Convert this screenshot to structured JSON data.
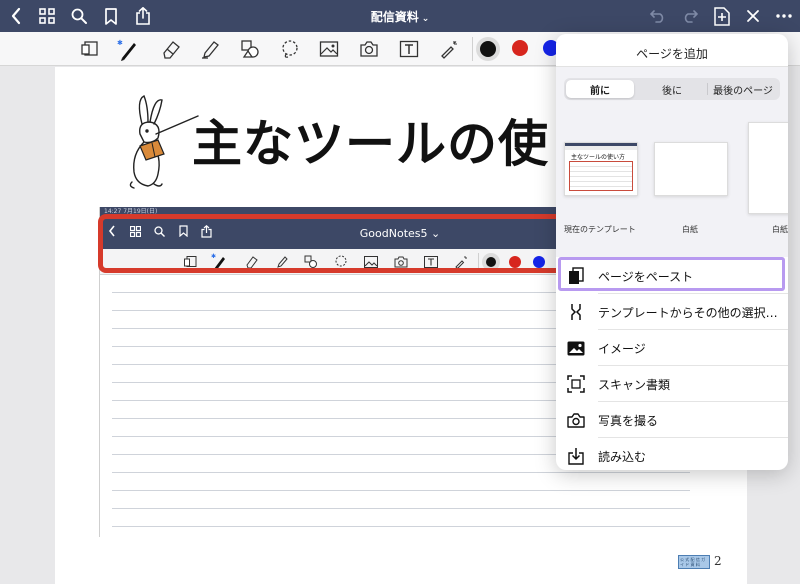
{
  "nav": {
    "title": "配信資料",
    "chevron": "⌄"
  },
  "colors": {
    "navbar": "#3d4866",
    "black_pen": "#111111",
    "red_pen": "#d7261e",
    "blue_pen": "#1524e8",
    "highlight": "#b89af0",
    "callout_red": "#d63a2b"
  },
  "toolbar": {
    "icons": [
      "page-view-icon",
      "pen-icon",
      "eraser-icon",
      "highlighter-icon",
      "shapes-icon",
      "lasso-icon",
      "image-icon",
      "camera-icon",
      "text-box-icon",
      "laser-pointer-icon"
    ]
  },
  "document": {
    "heading": "主なツールの使",
    "page_number": "2",
    "stamp_text": "公 式 配 信 ガ イ ド 資 料",
    "embedded": {
      "status": "14:27  7月19日(日)",
      "title": "GoodNotes5",
      "chevron": "⌄"
    }
  },
  "popover": {
    "title": "ページを追加",
    "segments": [
      "前に",
      "後に",
      "最後のページ"
    ],
    "active_segment": "前に",
    "thumbnails": [
      {
        "label": "現在のテンプレート",
        "mini_title": "主なツールの使い方"
      },
      {
        "label": "白紙"
      },
      {
        "label": "白紙"
      }
    ],
    "menu": [
      {
        "icon": "paste-page-icon",
        "label": "ページをペースト"
      },
      {
        "icon": "template-icon",
        "label": "テンプレートからその他の選択…"
      },
      {
        "icon": "image-icon",
        "label": "イメージ"
      },
      {
        "icon": "scan-icon",
        "label": "スキャン書類"
      },
      {
        "icon": "camera-icon",
        "label": "写真を撮る"
      },
      {
        "icon": "import-icon",
        "label": "読み込む"
      }
    ]
  }
}
